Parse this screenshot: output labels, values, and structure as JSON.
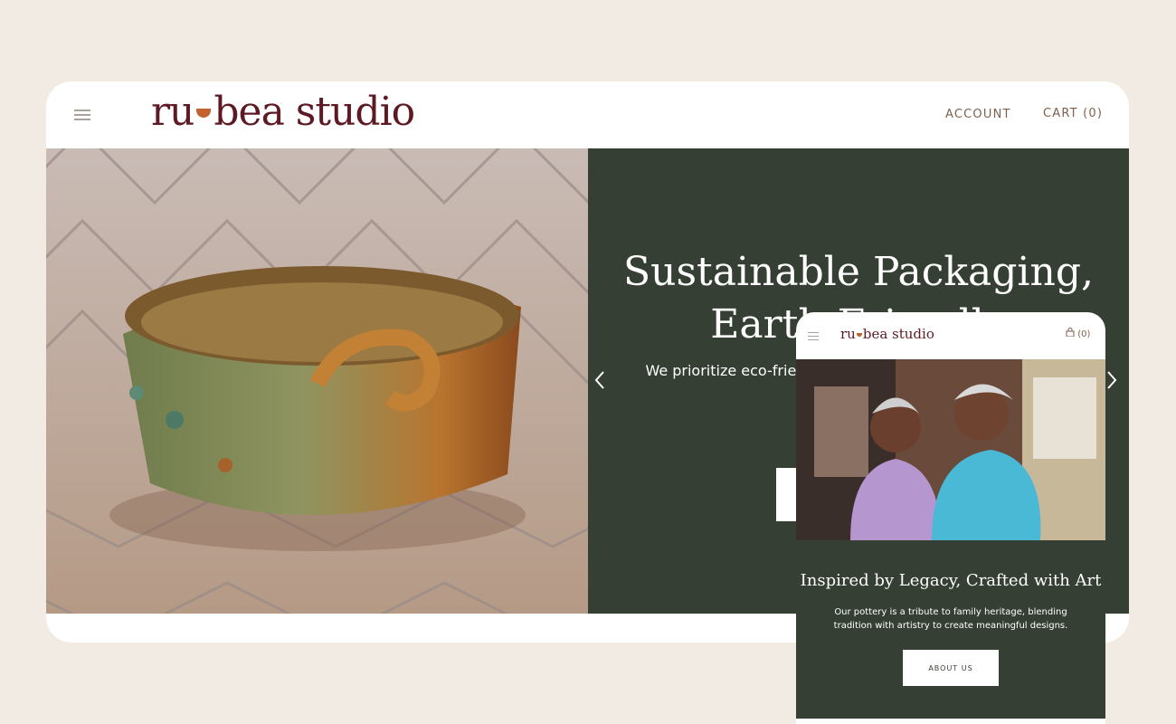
{
  "header": {
    "menu_icon": "hamburger-menu-icon",
    "logo_left": "ru",
    "logo_right": "bea studio",
    "account_label": "ACCOUNT",
    "cart_label": "CART (0)"
  },
  "hero": {
    "title": "Sustainable Packaging, Earth-Friendly",
    "text": "We prioritize eco-friendly packaging so your order is safely packed",
    "prev_icon": "chevron-left-icon",
    "next_icon": "chevron-right-icon"
  },
  "mobile": {
    "logo_left": "ru",
    "logo_right": "bea studio",
    "cart_icon": "lock-bag-icon",
    "cart_count": "(0)",
    "title": "Inspired by Legacy, Crafted with Art",
    "text": "Our pottery is a tribute to family heritage, blending tradition with artistry to create meaningful designs.",
    "button_label": "ABOUT US"
  },
  "colors": {
    "background": "#f1ebe4",
    "brand": "#5e1a24",
    "accent": "#c2632f",
    "hero_panel": "#363f33"
  }
}
